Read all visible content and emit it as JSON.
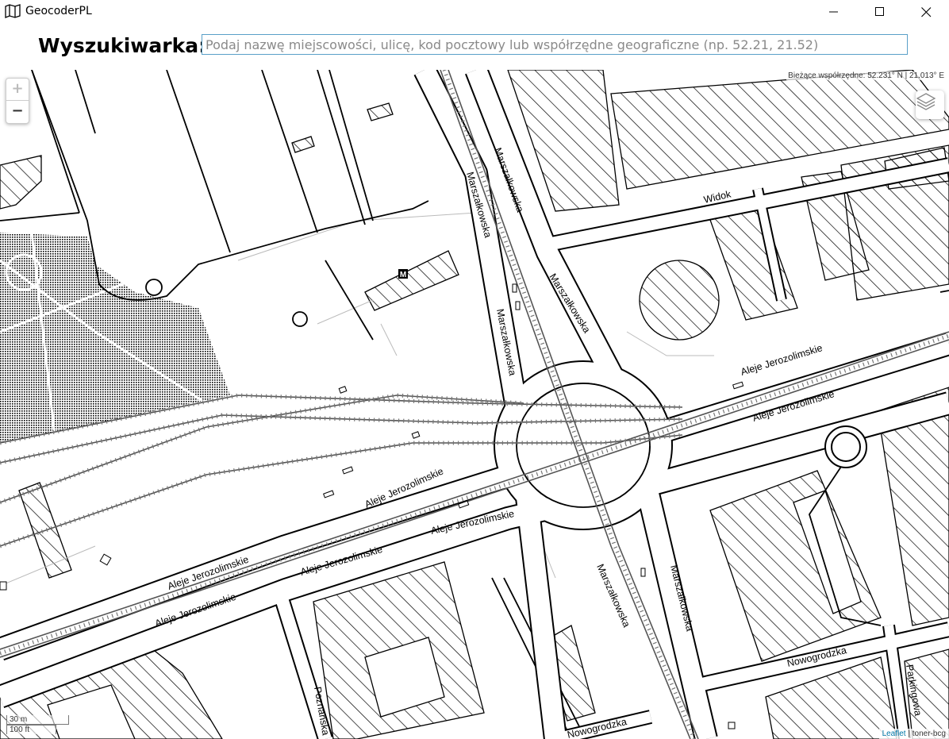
{
  "window": {
    "title": "GeocoderPL",
    "controls": [
      "minimize",
      "maximize",
      "close"
    ]
  },
  "search": {
    "label": "Wyszukiwarka:",
    "placeholder": "Podaj nazwę miejscowości, ulicę, kod pocztowy lub współrzędne geograficzne (np. 52.21, 21.52)",
    "value": ""
  },
  "map": {
    "coordinates_text": "Bieżące współrzędne: 52.231° N | 21.013° E",
    "zoom_in": "+",
    "zoom_out": "−",
    "scale_metric": "30 m",
    "scale_imperial": "100 ft",
    "attribution_link": "Leaflet",
    "attribution_separator": " | ",
    "attribution_text": "toner-bcg",
    "metro_symbol": "M",
    "street_labels": {
      "marszalkowska_1": "Marszałkowska",
      "marszalkowska_2": "Marszałkowska",
      "marszalkowska_3": "Marszałkowska",
      "marszalkowska_4": "Marszałkowska",
      "marszalkowska_5": "Marszałkowska",
      "marszalkowska_6": "Marszałkowska",
      "widok": "Widok",
      "aleje_1": "Aleje Jerozolimskie",
      "aleje_2": "Aleje Jerozolimskie",
      "aleje_3": "Aleje Jerozolimskie",
      "aleje_4": "Aleje Jerozolimskie",
      "aleje_5": "Aleje Jerozolimskie",
      "aleje_6": "Aleje Jerozolimskie",
      "aleje_7": "Aleje Jerozolimskie",
      "nowogrodzka_1": "Nowogrodzka",
      "nowogrodzka_2": "Nowogrodzka",
      "parkingowa": "Parkingowa",
      "poznanska": "Poznańska"
    }
  },
  "icons": [
    "map-app-icon",
    "minimize-icon",
    "maximize-icon",
    "close-icon",
    "layers-icon",
    "metro-icon"
  ]
}
